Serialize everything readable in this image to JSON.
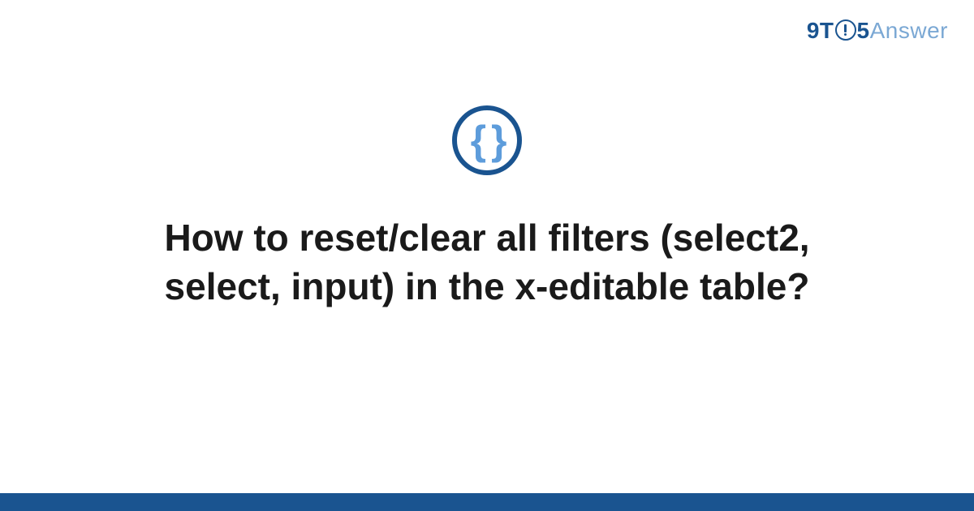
{
  "logo": {
    "part1": "9T",
    "part2": "5",
    "part3": "Answer"
  },
  "icon": {
    "symbol": "{ }"
  },
  "title": "How to reset/clear all filters (select2, select, input) in the x-editable table?",
  "colors": {
    "primary": "#1a5490",
    "accent": "#5d9cdb",
    "logoLight": "#7ba8d4"
  }
}
